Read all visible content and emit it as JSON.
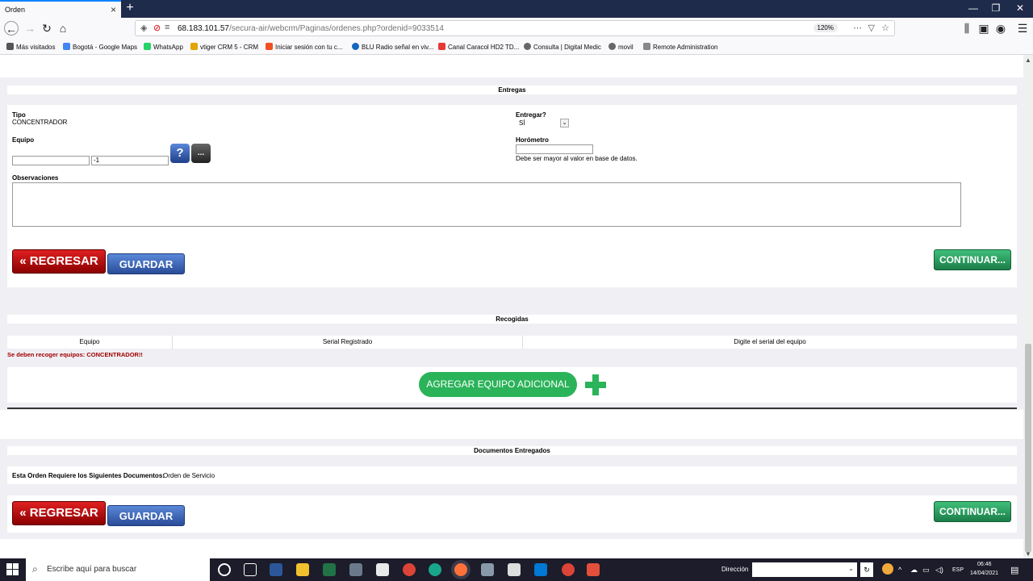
{
  "browser": {
    "tab_title": "Orden",
    "tab_close": "×",
    "new_tab": "+",
    "url_host": "68.183.101.57",
    "url_path": "/secura-air/webcrm/Paginas/ordenes.php?ordenid=9033514",
    "zoom": "120%",
    "window_controls": [
      "—",
      "❐",
      "✕"
    ],
    "nav_icons": [
      "←",
      "→",
      "↻",
      "⌂"
    ]
  },
  "bookmarks": [
    {
      "label": "Más visitados",
      "color": "#555555"
    },
    {
      "label": "Bogotá - Google Maps",
      "color": "#4285f4"
    },
    {
      "label": "WhatsApp",
      "color": "#25d366"
    },
    {
      "label": "vtiger CRM 5 - CRM",
      "color": "#e2a400"
    },
    {
      "label": "Iniciar sesión con tu c...",
      "color": "#f25022"
    },
    {
      "label": "BLU Radio señal en viv...",
      "color": "#1565c0"
    },
    {
      "label": "Canal Caracol HD2 TD...",
      "color": "#e53935"
    },
    {
      "label": "Consulta | Digital Medic",
      "color": "#666666"
    },
    {
      "label": "movil",
      "color": "#666666"
    },
    {
      "label": "Remote Administration",
      "color": "#888888"
    }
  ],
  "entregas": {
    "title": "Entregas",
    "tipo_label": "Tipo",
    "tipo_value": "CONCENTRADOR",
    "equipo_label": "Equipo",
    "equipo_input_1": "",
    "equipo_input_2": "-1",
    "help_button": "?",
    "more_button": "...",
    "entregar_label": "Entregar?",
    "entregar_value": "SÍ",
    "horometro_label": "Horómetro",
    "horometro_value": "",
    "horometro_hint": "Debe ser mayor al valor en base de datos.",
    "observaciones_label": "Observaciones",
    "observaciones_value": ""
  },
  "actions": {
    "regresar": "« REGRESAR",
    "guardar": "GUARDAR",
    "continuar": "CONTINUAR..."
  },
  "recogidas": {
    "title": "Recogidas",
    "columns": [
      "Equipo",
      "Serial Registrado",
      "Digite el serial del equipo"
    ],
    "warning": "Se deben recoger equipos: CONCENTRADOR!!",
    "add_button": "AGREGAR EQUIPO ADICIONAL"
  },
  "documentos": {
    "title": "Documentos Entregados",
    "requirement_label": "Esta Orden Requiere los Siguientes Documentos:",
    "requirement_value": "Orden de Servicio"
  },
  "taskbar": {
    "search_placeholder": "Escribe aquí para buscar",
    "direccion_label": "Dirección",
    "language": "ESP",
    "time": "06:46",
    "date": "14/04/2021"
  }
}
